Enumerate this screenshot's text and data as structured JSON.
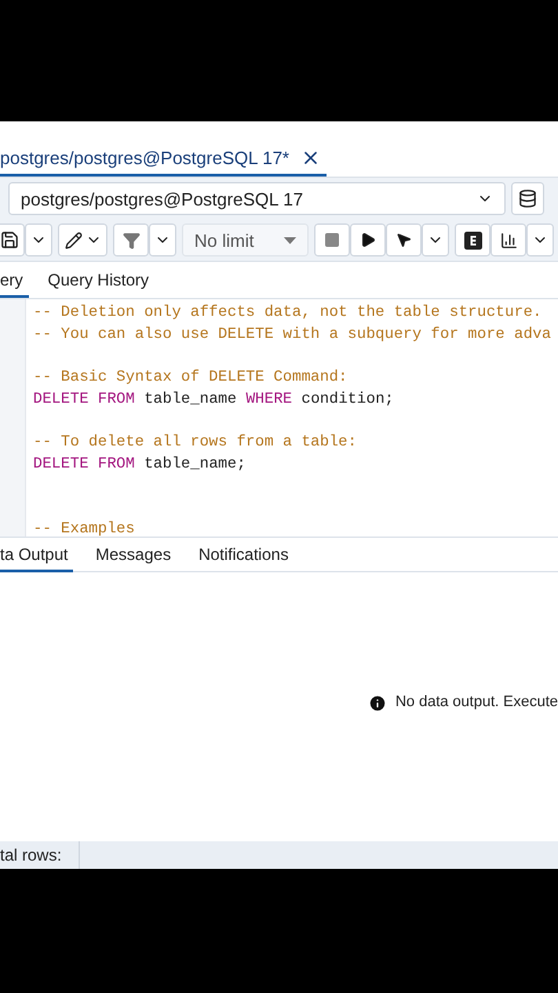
{
  "query_tab": {
    "title": "postgres/postgres@PostgreSQL 17*",
    "selected": true
  },
  "connection": {
    "value": "postgres/postgres@PostgreSQL 17"
  },
  "toolbar": {
    "limit": "No limit"
  },
  "editor_tabs": [
    {
      "label": "ery",
      "selected": true
    },
    {
      "label": "Query History",
      "selected": false
    }
  ],
  "code_lines": [
    {
      "kind": "code",
      "tokens": [
        {
          "kind": "comment",
          "text": "-- Deletion only affects data, not the table structure."
        }
      ]
    },
    {
      "kind": "code",
      "tokens": [
        {
          "kind": "comment",
          "text": "-- You can also use DELETE with a subquery for more adva"
        }
      ]
    },
    {
      "kind": "blank"
    },
    {
      "kind": "code",
      "tokens": [
        {
          "kind": "comment",
          "text": "-- Basic Syntax of DELETE Command:"
        }
      ]
    },
    {
      "kind": "code",
      "tokens": [
        {
          "kind": "keyword",
          "text": "DELETE FROM"
        },
        {
          "kind": "plain",
          "text": " table_name "
        },
        {
          "kind": "keyword",
          "text": "WHERE"
        },
        {
          "kind": "plain",
          "text": " condition;"
        }
      ]
    },
    {
      "kind": "blank"
    },
    {
      "kind": "code",
      "tokens": [
        {
          "kind": "comment",
          "text": "-- To delete all rows from a table:"
        }
      ]
    },
    {
      "kind": "code",
      "tokens": [
        {
          "kind": "keyword",
          "text": "DELETE FROM"
        },
        {
          "kind": "plain",
          "text": " table_name;"
        }
      ]
    },
    {
      "kind": "blank"
    },
    {
      "kind": "blank"
    },
    {
      "kind": "code",
      "tokens": [
        {
          "kind": "comment",
          "text": "-- Examples"
        }
      ]
    }
  ],
  "output_tabs": [
    {
      "label": "ta Output",
      "selected": true
    },
    {
      "label": "Messages",
      "selected": false
    },
    {
      "label": "Notifications",
      "selected": false
    }
  ],
  "output_message": "No data output. Execute",
  "status_bar": {
    "total_rows": "tal rows:"
  }
}
